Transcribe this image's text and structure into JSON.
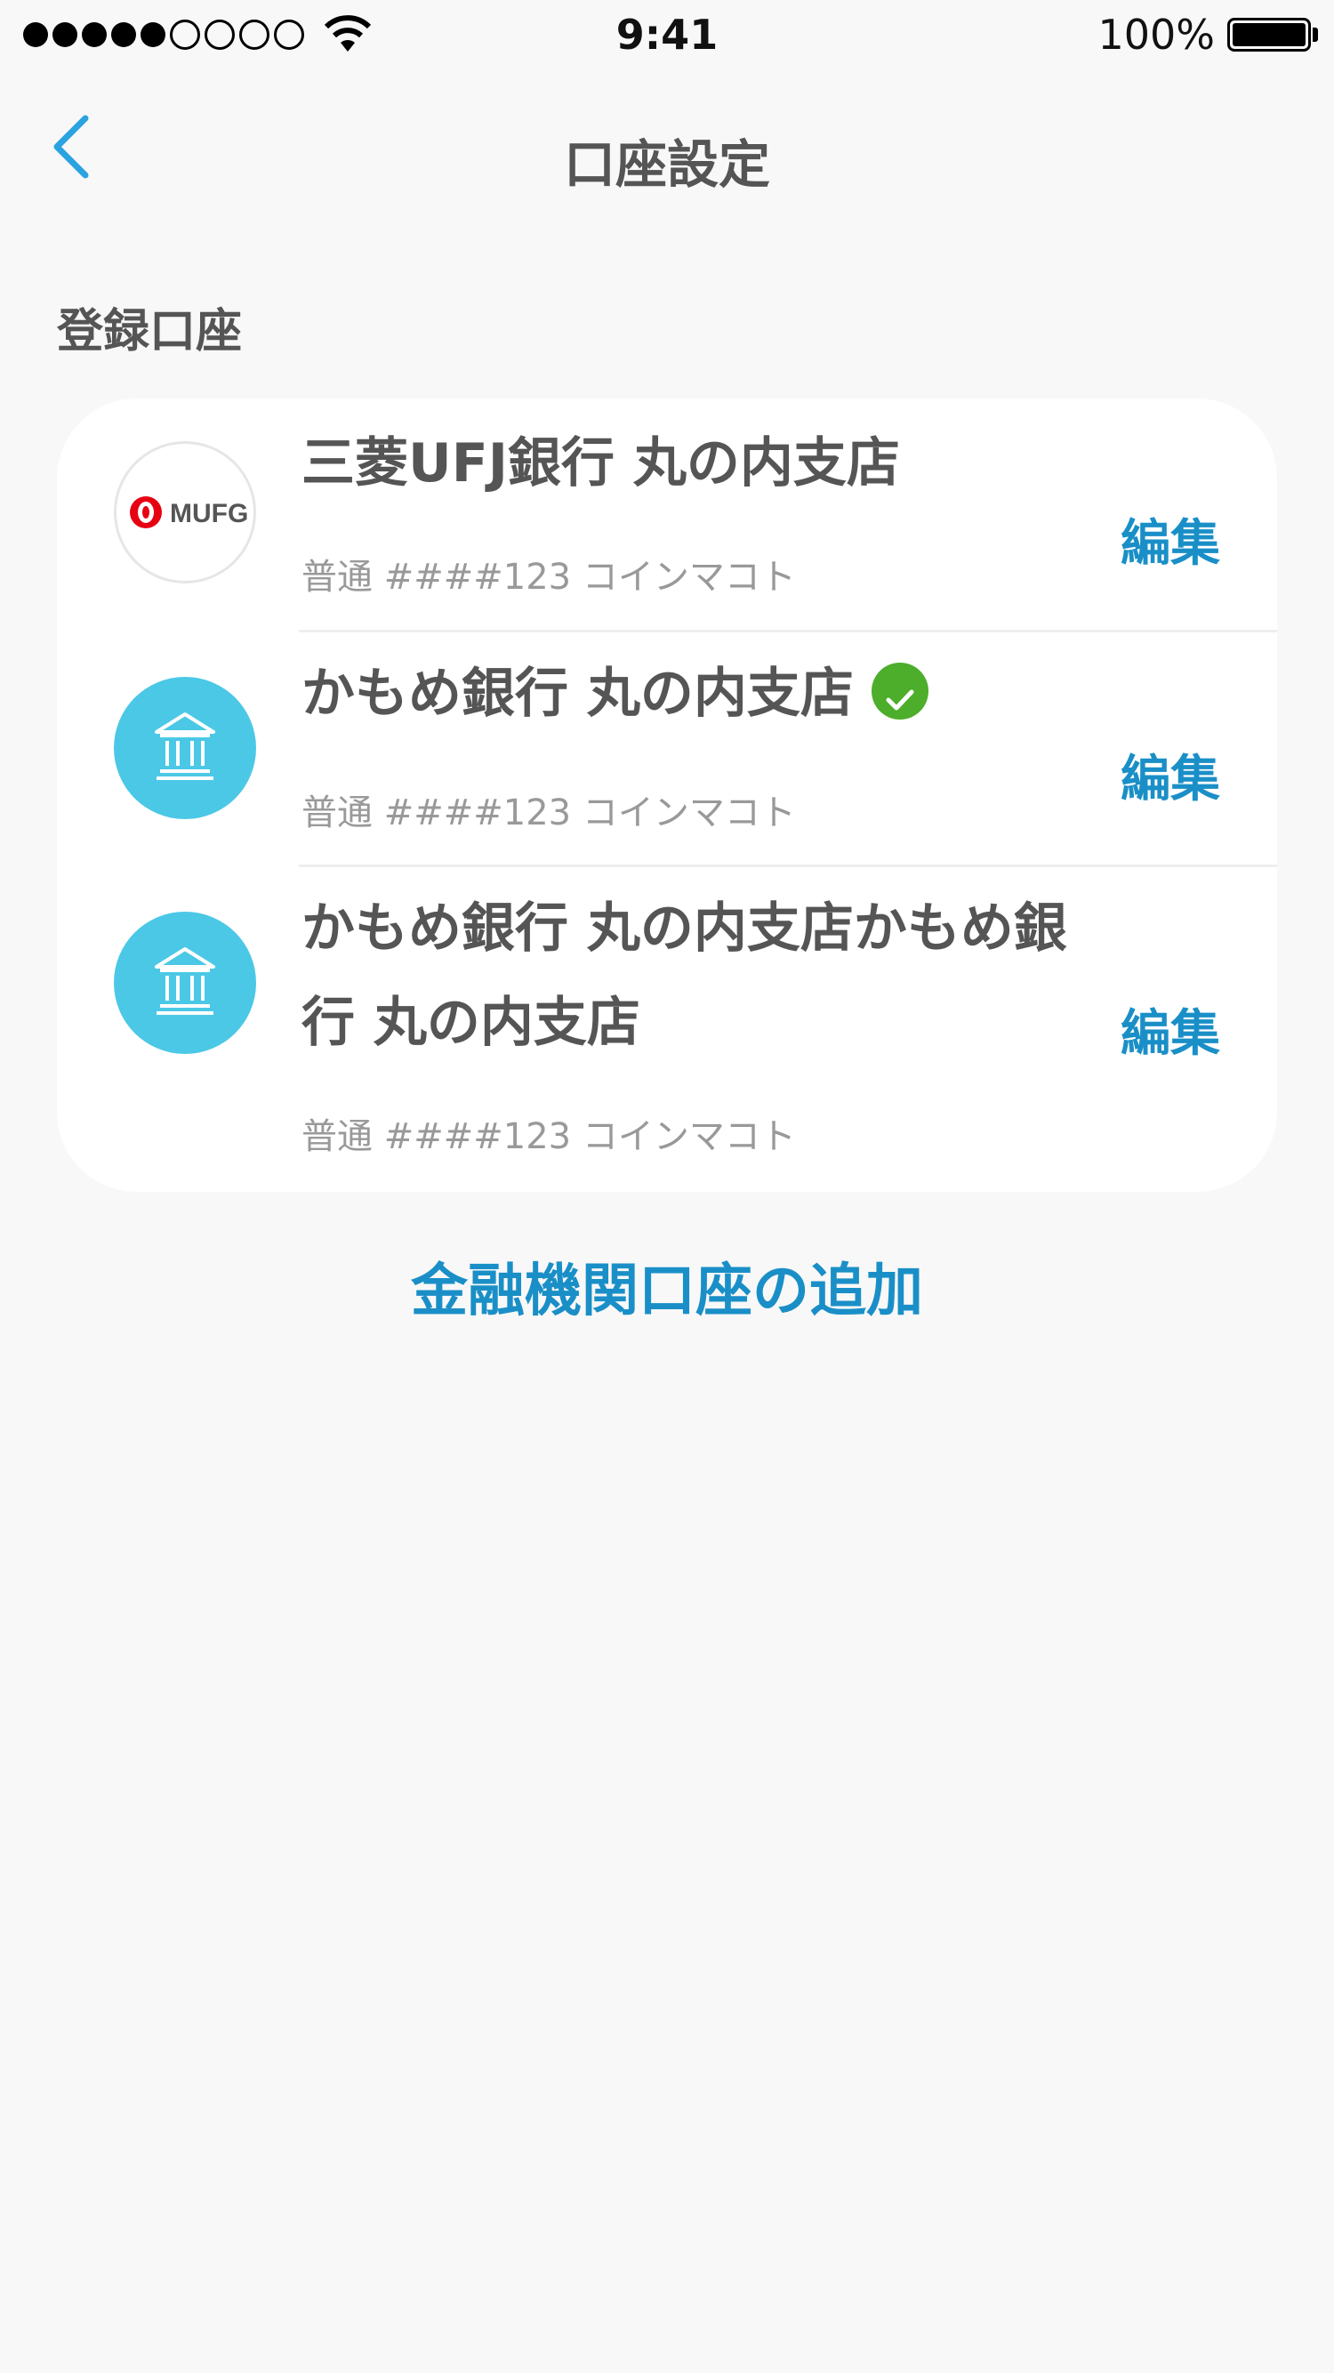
{
  "status_bar": {
    "time": "9:41",
    "battery": "100%",
    "signal_filled": 5,
    "signal_empty": 4
  },
  "nav": {
    "title": "口座設定",
    "back_icon": "chevron-left-icon"
  },
  "section_label": "登録口座",
  "accounts": [
    {
      "bank_name": "三菱UFJ銀行 丸の内支店",
      "info": "普通 ####123 コインマコト",
      "edit_label": "編集",
      "logo_text": "MUFG",
      "logo_icon": "mufg-logo-icon",
      "verified": false
    },
    {
      "bank_name": "かもめ銀行 丸の内支店",
      "info": "普通 ####123 コインマコト",
      "edit_label": "編集",
      "logo_icon": "bank-building-icon",
      "verified": true
    },
    {
      "bank_name": "かもめ銀行 丸の内支店かもめ銀行 丸の内支店",
      "info": "普通 ####123 コインマコト",
      "edit_label": "編集",
      "logo_icon": "bank-building-icon",
      "verified": false
    }
  ],
  "add_account_label": "金融機関口座の追加",
  "colors": {
    "accent": "#1a8fc7",
    "bank_icon_bg": "#4bc8e6",
    "verified": "#4cae2a",
    "mufg_red": "#e60012"
  }
}
